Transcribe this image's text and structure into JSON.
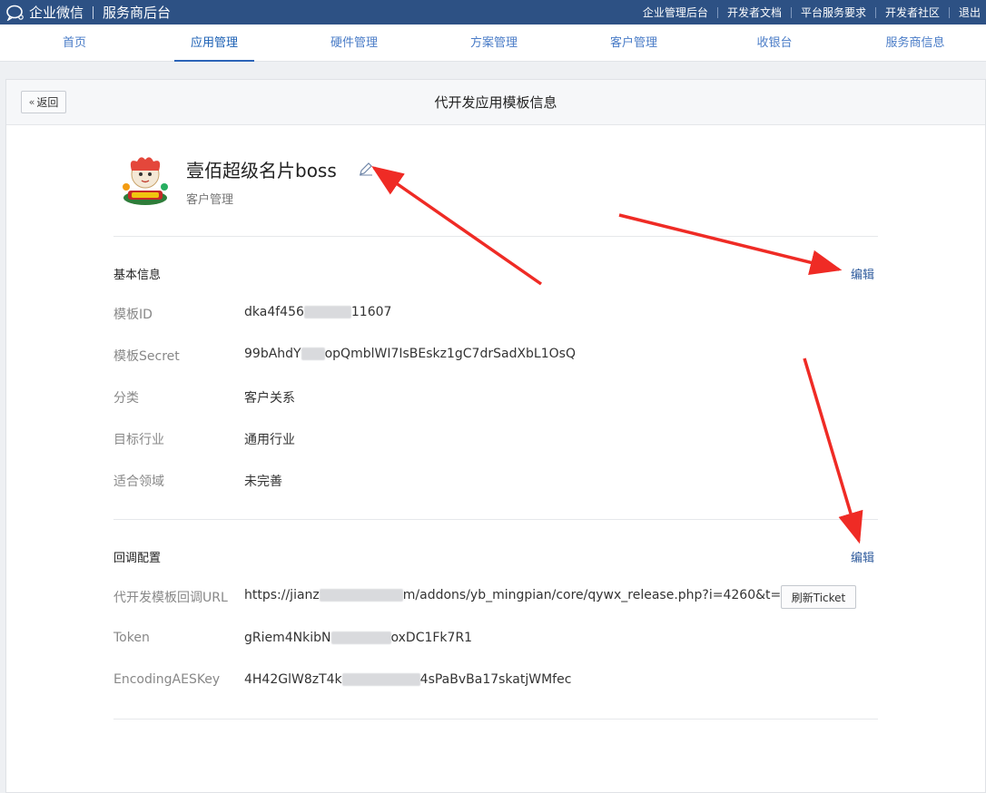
{
  "topbar": {
    "brand": "企业微信",
    "subtitle": "服务商后台",
    "links": [
      "企业管理后台",
      "开发者文档",
      "平台服务要求",
      "开发者社区",
      "退出"
    ]
  },
  "nav": {
    "tabs": [
      "首页",
      "应用管理",
      "硬件管理",
      "方案管理",
      "客户管理",
      "收银台",
      "服务商信息"
    ],
    "active": "应用管理"
  },
  "page": {
    "back_label": "返回",
    "title": "代开发应用模板信息"
  },
  "app": {
    "name": "壹佰超级名片boss",
    "category": "客户管理"
  },
  "basic": {
    "section_title": "基本信息",
    "edit_label": "编辑",
    "rows": [
      {
        "label": "模板ID",
        "value_a": "dka4f456",
        "value_b": "11607"
      },
      {
        "label": "模板Secret",
        "value_a": "99bAhdY",
        "value_b": "opQmblWI7IsBEskz1gC7drSadXbL1OsQ"
      },
      {
        "label": "分类",
        "value": "客户关系"
      },
      {
        "label": "目标行业",
        "value": "通用行业"
      },
      {
        "label": "适合领域",
        "value": "未完善"
      }
    ]
  },
  "callback": {
    "section_title": "回调配置",
    "edit_label": "编辑",
    "ticket_button": "刷新Ticket",
    "rows": [
      {
        "label": "代开发模板回调URL",
        "value_a": "https://jianz",
        "value_b": "m/addons/yb_mingpian/core/qywx_release.php?i=4260&t=1"
      },
      {
        "label": "Token",
        "value_a": "gRiem4NkibN",
        "value_b": "oxDC1Fk7R1"
      },
      {
        "label": "EncodingAESKey",
        "value_a": "4H42GlW8zT4k",
        "value_b": "4sPaBvBa17skatjWMfec"
      }
    ]
  },
  "colors": {
    "topbar": "#2d5184",
    "link": "#2d5a9c",
    "arrow": "#ef2b25"
  }
}
